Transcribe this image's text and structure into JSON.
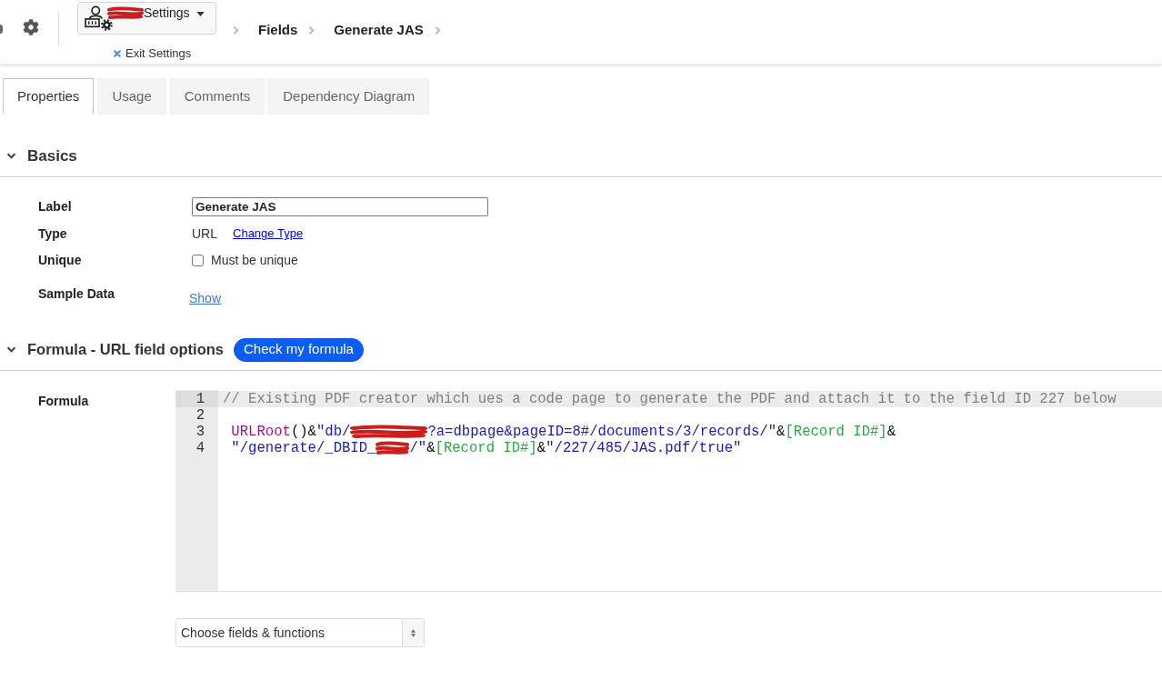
{
  "header": {
    "settings_menu": {
      "label": "Settings",
      "redacted": true
    },
    "exit_link": "Exit Settings",
    "breadcrumbs": [
      "Fields",
      "Generate JAS"
    ]
  },
  "tabs": [
    {
      "label": "Properties",
      "selected": true
    },
    {
      "label": "Usage",
      "selected": false
    },
    {
      "label": "Comments",
      "selected": false
    },
    {
      "label": "Dependency Diagram",
      "selected": false
    }
  ],
  "basics": {
    "title": "Basics",
    "expanded": true,
    "fields": [
      {
        "kind": "text_input",
        "label": "Label",
        "value": "Generate JAS"
      },
      {
        "kind": "value_link",
        "label": "Type",
        "value": "URL",
        "link": "Change Type"
      },
      {
        "kind": "checkbox",
        "label": "Unique",
        "option": "Must be unique",
        "checked": false
      },
      {
        "kind": "link",
        "label": "Sample Data",
        "link": "Show"
      }
    ]
  },
  "formula_section": {
    "title": "Formula - URL field options",
    "expanded": true,
    "check_button": "Check my formula",
    "formula": {
      "label": "Formula",
      "lines": [
        {
          "number": "1",
          "active": true,
          "tokens": [
            {
              "kind": "comment",
              "text": "// Existing PDF creator which ues a code page to generate the PDF and attach it to the field ID 227 below"
            }
          ]
        },
        {
          "number": "2",
          "active": false
        },
        {
          "number": "3",
          "active": false,
          "tokens": [
            {
              "kind": "function",
              "text": " URLRoot"
            },
            {
              "kind": "plain",
              "text": "()&"
            },
            {
              "kind": "string",
              "text": "\"db/"
            },
            {
              "kind": "redaction"
            },
            {
              "kind": "string",
              "text": "?a=dbpage&pageID=8#/documents/3/records/\""
            },
            {
              "kind": "plain",
              "text": "&"
            },
            {
              "kind": "field",
              "text": "[Record ID#]"
            },
            {
              "kind": "plain",
              "text": "&"
            }
          ]
        },
        {
          "number": "4",
          "active": false,
          "tokens": [
            {
              "kind": "string",
              "text": " \"/generate/_DBID_"
            },
            {
              "kind": "redaction"
            },
            {
              "kind": "string",
              "text": "/\""
            },
            {
              "kind": "plain",
              "text": "&"
            },
            {
              "kind": "field",
              "text": "[Record ID#]"
            },
            {
              "kind": "plain",
              "text": "&"
            },
            {
              "kind": "string",
              "text": "\"/227/485/JAS.pdf/true\""
            }
          ]
        }
      ]
    },
    "picker": {
      "value": "Choose fields & functions"
    }
  }
}
